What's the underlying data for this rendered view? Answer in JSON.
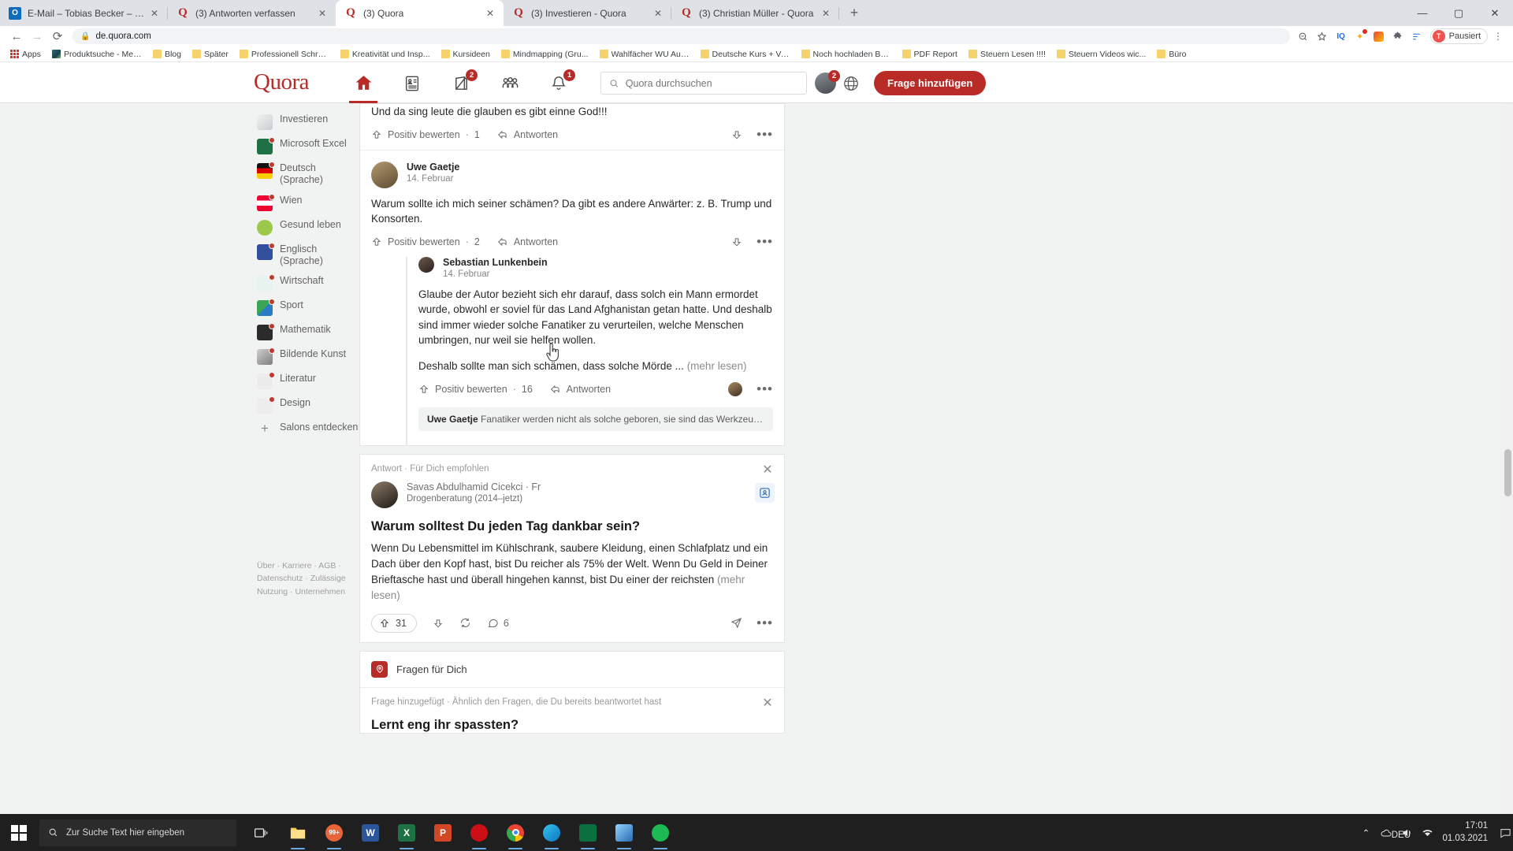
{
  "browser": {
    "tabs": [
      {
        "title": "E-Mail – Tobias Becker – Outlook",
        "favicon": "outlook-icon",
        "active": false
      },
      {
        "title": "(3) Antworten verfassen",
        "favicon": "quora-icon",
        "active": false
      },
      {
        "title": "(3) Quora",
        "favicon": "quora-icon",
        "active": true
      },
      {
        "title": "(3) Investieren - Quora",
        "favicon": "quora-icon",
        "active": false
      },
      {
        "title": "(3) Christian Müller - Quora",
        "favicon": "quora-icon",
        "active": false
      }
    ],
    "new_tab_label": "+",
    "window_controls": {
      "minimize": "—",
      "maximize": "▢",
      "close": "✕"
    },
    "nav": {
      "back": "←",
      "forward": "→",
      "reload": "⟳"
    },
    "address": {
      "value": "de.quora.com",
      "lock": "🔒"
    },
    "toolbar_icons": [
      "zoom-icon",
      "bookmark-star-icon",
      "iq-extension-icon",
      "extension-icon",
      "color-extension-icon",
      "puzzle-extension-icon",
      "list-extension-icon",
      "menu-icon"
    ],
    "profile": {
      "initial": "T",
      "label": "Pausiert"
    },
    "bookmarks": [
      {
        "label": "Apps",
        "icon": "apps-grid-icon"
      },
      {
        "label": "Produktsuche - Mer...",
        "icon": "image-icon"
      },
      {
        "label": "Blog",
        "icon": "folder-icon"
      },
      {
        "label": "Später",
        "icon": "folder-icon"
      },
      {
        "label": "Professionell Schrei...",
        "icon": "folder-icon"
      },
      {
        "label": "Kreativität und Insp...",
        "icon": "folder-icon"
      },
      {
        "label": "Kursideen",
        "icon": "folder-icon"
      },
      {
        "label": "Mindmapping  (Gru...",
        "icon": "folder-icon"
      },
      {
        "label": "Wahlfächer WU Aus...",
        "icon": "folder-icon"
      },
      {
        "label": "Deutsche Kurs + Vo...",
        "icon": "folder-icon"
      },
      {
        "label": "Noch hochladen Bu...",
        "icon": "folder-icon"
      },
      {
        "label": "PDF Report",
        "icon": "folder-icon"
      },
      {
        "label": "Steuern Lesen !!!!",
        "icon": "folder-icon"
      },
      {
        "label": "Steuern Videos wic...",
        "icon": "folder-icon"
      },
      {
        "label": "Büro",
        "icon": "folder-icon"
      }
    ]
  },
  "quora": {
    "logo": "Quora",
    "nav": [
      {
        "name": "home",
        "badge": null
      },
      {
        "name": "answers",
        "badge": null
      },
      {
        "name": "write",
        "badge": "2"
      },
      {
        "name": "spaces",
        "badge": null
      },
      {
        "name": "notifications",
        "badge": "1"
      }
    ],
    "search": {
      "placeholder": "Quora durchsuchen"
    },
    "avatar_badge": "2",
    "ask_button": "Frage hinzufügen",
    "sidebar": [
      {
        "label": "Investieren",
        "dot": false,
        "icon": "topic-investieren-icon"
      },
      {
        "label": "Microsoft Excel",
        "dot": true,
        "icon": "topic-excel-icon"
      },
      {
        "label": "Deutsch (Sprache)",
        "dot": true,
        "icon": "topic-deutsch-icon"
      },
      {
        "label": "Wien",
        "dot": true,
        "icon": "topic-wien-icon"
      },
      {
        "label": "Gesund leben",
        "dot": false,
        "icon": "topic-gesund-icon"
      },
      {
        "label": "Englisch (Sprache)",
        "dot": true,
        "icon": "topic-englisch-icon"
      },
      {
        "label": "Wirtschaft",
        "dot": true,
        "icon": "topic-wirtschaft-icon"
      },
      {
        "label": "Sport",
        "dot": true,
        "icon": "topic-sport-icon"
      },
      {
        "label": "Mathematik",
        "dot": true,
        "icon": "topic-mathematik-icon"
      },
      {
        "label": "Bildende Kunst",
        "dot": true,
        "icon": "topic-kunst-icon"
      },
      {
        "label": "Literatur",
        "dot": true,
        "icon": "topic-literatur-icon"
      },
      {
        "label": "Design",
        "dot": true,
        "icon": "topic-design-icon"
      },
      {
        "label": "Salons entdecken",
        "dot": false,
        "icon": "plus-icon"
      }
    ],
    "footer": "Über · Karriere · AGB · Datenschutz · Zulässige Nutzung · Unternehmen",
    "feed": {
      "partial_comment": {
        "text": "Und da sing leute die glauben es gibt einne God!!!",
        "upvote_label": "Positiv bewerten",
        "upvote_count": "1",
        "reply_label": "Antworten"
      },
      "comment": {
        "author": "Uwe Gaetje",
        "date": "14. Februar",
        "text": "Warum sollte ich mich seiner schämen? Da gibt es andere Anwärter: z. B. Trump und Konsorten.",
        "upvote_label": "Positiv bewerten",
        "upvote_count": "2",
        "reply_label": "Antworten",
        "nested": {
          "author": "Sebastian Lunkenbein",
          "date": "14. Februar",
          "text1": "Glaube der Autor bezieht sich ehr darauf, dass solch ein Mann ermordet wurde, obwohl er soviel für das Land Afghanistan getan hatte. Und deshalb sind immer wieder solche Fanatiker zu verurteilen, welche Menschen umbringen, nur weil sie helfen wollen.",
          "text2": "Deshalb sollte man sich schämen, dass solche Mörde ...",
          "more_label": "(mehr lesen)",
          "upvote_label": "Positiv bewerten",
          "upvote_count": "16",
          "reply_label": "Antworten",
          "quoted_author": "Uwe Gaetje",
          "quoted_text": "Fanatiker werden nicht als solche geboren, sie sind das Werkzeug dere..."
        }
      },
      "recommended": {
        "label": "Antwort · Für Dich empfohlen",
        "close": "✕",
        "author": "Savas Abdulhamid Cicekci",
        "time": "· Fr",
        "credential": "Drogenberatung (2014–jetzt)",
        "title": "Warum solltest Du jeden Tag dankbar sein?",
        "body": "Wenn Du Lebensmittel im Kühlschrank, saubere Kleidung, einen Schlafplatz und ein Dach über den Kopf hast, bist Du reicher als 75% der Welt. Wenn Du Geld in Deiner Brieftasche hast und überall hingehen kannst, bist Du einer der reichsten",
        "more_label": "(mehr lesen)",
        "upvote_count": "31",
        "comment_count": "6"
      },
      "questions": {
        "header": "Fragen für Dich",
        "added_label": "Frage hinzugefügt · Ähnlich den Fragen, die Du bereits beantwortet hast",
        "close": "✕",
        "title": "Lernt eng ihr spassten?"
      }
    }
  },
  "taskbar": {
    "search_placeholder": "Zur Suche Text hier eingeben",
    "apps": [
      {
        "name": "task-view-icon"
      },
      {
        "name": "file-explorer-icon"
      },
      {
        "name": "media-player-icon",
        "badge": "99+"
      },
      {
        "name": "word-icon"
      },
      {
        "name": "excel-icon"
      },
      {
        "name": "powerpoint-icon"
      },
      {
        "name": "opera-icon"
      },
      {
        "name": "chrome-icon"
      },
      {
        "name": "edge-icon"
      },
      {
        "name": "photoshop-icon"
      },
      {
        "name": "image-app-icon"
      },
      {
        "name": "spotify-icon"
      }
    ],
    "tray": {
      "chevron": "⌃",
      "onedrive": "☁",
      "volume": "🔊",
      "network": "📶",
      "language": "DEU"
    },
    "clock": {
      "time": "17:01",
      "date": "01.03.2021"
    }
  },
  "colors": {
    "quora_red": "#b92b27",
    "chrome_tabstrip": "#dee1e6",
    "page_bg": "#f1f2f2",
    "taskbar": "#1f1f1f",
    "accent_blue": "#1a73e8"
  }
}
